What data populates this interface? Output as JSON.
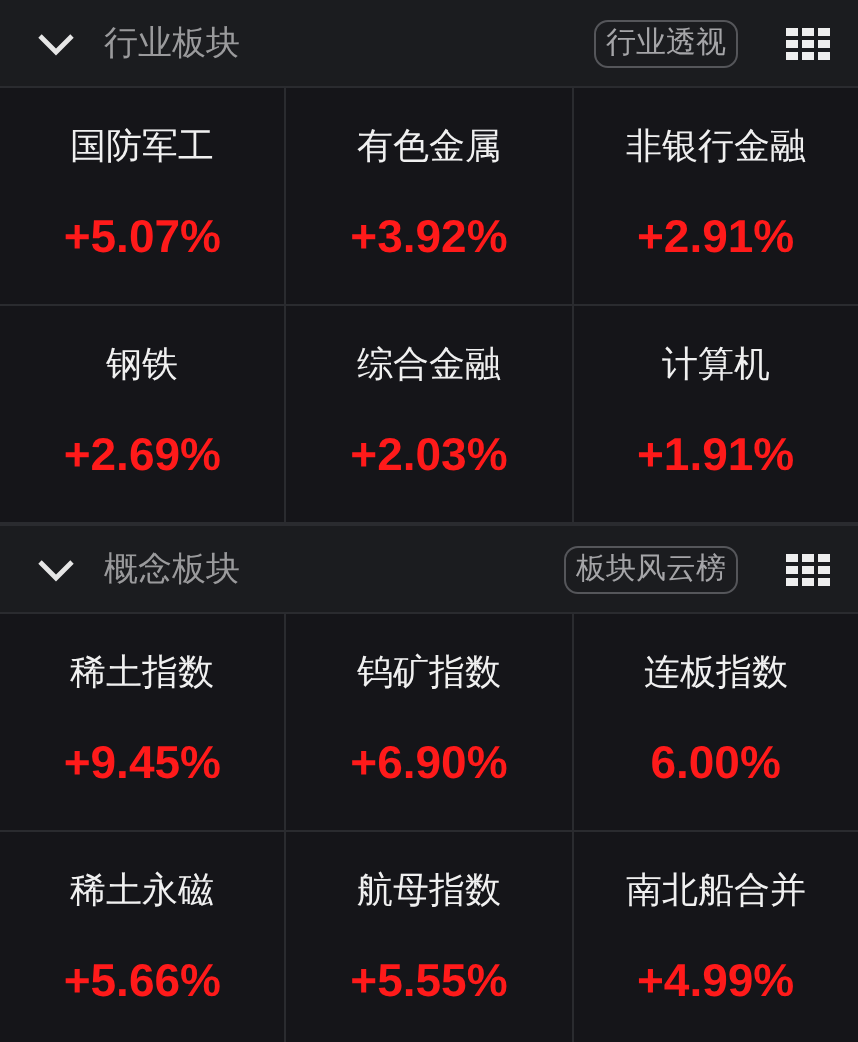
{
  "sections": [
    {
      "title": "行业板块",
      "expanded": true,
      "action": "行业透视",
      "tiles": [
        {
          "name": "国防军工",
          "change": "+5.07%"
        },
        {
          "name": "有色金属",
          "change": "+3.92%"
        },
        {
          "name": "非银行金融",
          "change": "+2.91%"
        },
        {
          "name": "钢铁",
          "change": "+2.69%"
        },
        {
          "name": "综合金融",
          "change": "+2.03%"
        },
        {
          "name": "计算机",
          "change": "+1.91%"
        }
      ]
    },
    {
      "title": "概念板块",
      "expanded": true,
      "action": "板块风云榜",
      "tiles": [
        {
          "name": "稀土指数",
          "change": "+9.45%"
        },
        {
          "name": "钨矿指数",
          "change": "+6.90%"
        },
        {
          "name": "连板指数",
          "change": "6.00%"
        },
        {
          "name": "稀土永磁",
          "change": "+5.66%"
        },
        {
          "name": "航母指数",
          "change": "+5.55%"
        },
        {
          "name": "南北船合并",
          "change": "+4.99%"
        }
      ]
    }
  ]
}
